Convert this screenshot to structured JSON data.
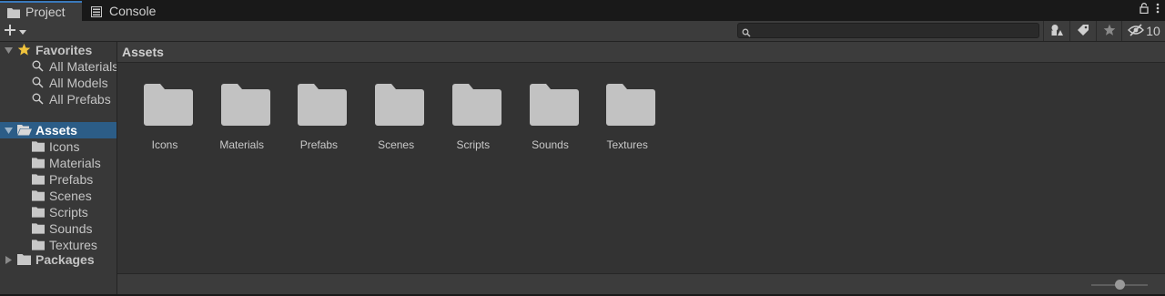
{
  "tabs": [
    {
      "label": "Project",
      "icon": "folder-icon",
      "active": true
    },
    {
      "label": "Console",
      "icon": "console-icon",
      "active": false
    }
  ],
  "toolbar": {
    "search_value": "",
    "hidden_count": "10"
  },
  "sidebar": {
    "favorites": {
      "label": "Favorites",
      "items": [
        "All Materials",
        "All Models",
        "All Prefabs"
      ]
    },
    "assets": {
      "label": "Assets",
      "items": [
        "Icons",
        "Materials",
        "Prefabs",
        "Scenes",
        "Scripts",
        "Sounds",
        "Textures"
      ]
    },
    "packages": {
      "label": "Packages"
    }
  },
  "main": {
    "breadcrumb": "Assets",
    "folders": [
      "Icons",
      "Materials",
      "Prefabs",
      "Scenes",
      "Scripts",
      "Sounds",
      "Textures"
    ]
  },
  "footer": {
    "zoom_level": 0.5
  },
  "colors": {
    "selection": "#2c5d87",
    "accent": "#3a79bb",
    "folder": "#c2c2c2",
    "star": "#f0c33c"
  }
}
